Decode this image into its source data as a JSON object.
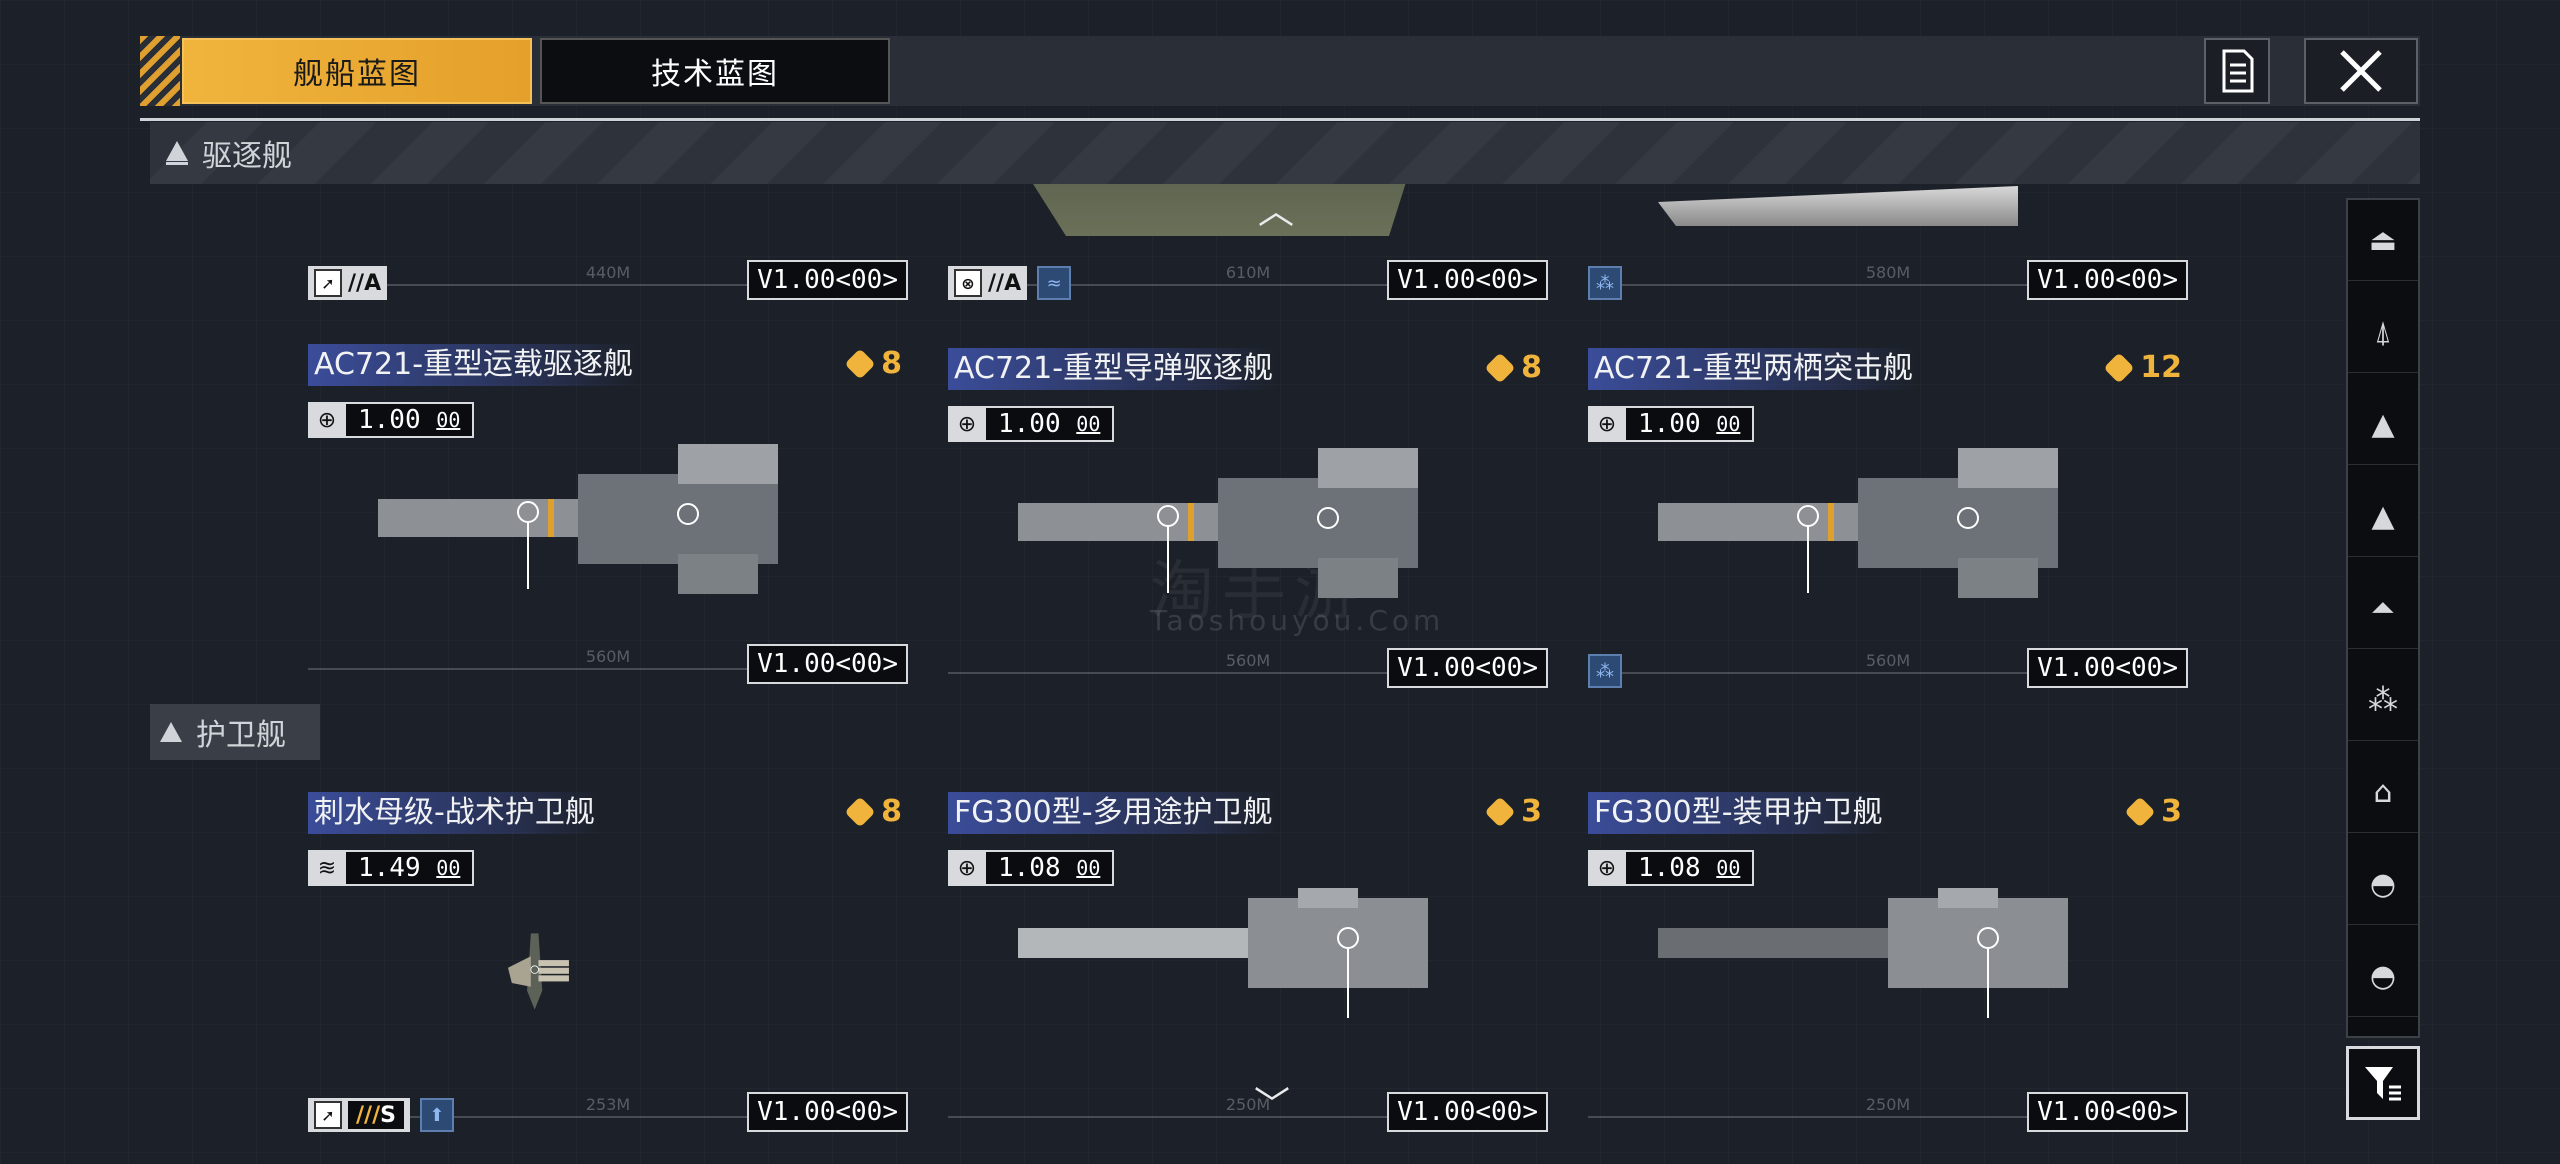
{
  "tabs": {
    "ship": "舰船蓝图",
    "tech": "技术蓝图"
  },
  "sections": {
    "destroyer": "驱逐舰",
    "frigate": "护卫舰"
  },
  "top_row": [
    {
      "length": "440M",
      "grade": "A",
      "version": "V1.00<00>"
    },
    {
      "length": "610M",
      "grade": "A",
      "version": "V1.00<00>"
    },
    {
      "length": "580M",
      "version": "V1.00<00>"
    }
  ],
  "destroyers": [
    {
      "name": "AC721-重型运载驱逐舰",
      "cost": "8",
      "val": "1.00",
      "sub": "00",
      "length": "560M",
      "version": "V1.00<00>"
    },
    {
      "name": "AC721-重型导弹驱逐舰",
      "cost": "8",
      "val": "1.00",
      "sub": "00",
      "length": "560M",
      "version": "V1.00<00>"
    },
    {
      "name": "AC721-重型两栖突击舰",
      "cost": "12",
      "val": "1.00",
      "sub": "00",
      "length": "560M",
      "version": "V1.00<00>"
    }
  ],
  "frigates": [
    {
      "name": "刺水母级-战术护卫舰",
      "cost": "8",
      "val": "1.49",
      "sub": "00",
      "length": "253M",
      "grade": "S",
      "version": "V1.00<00>"
    },
    {
      "name": "FG300型-多用途护卫舰",
      "cost": "3",
      "val": "1.08",
      "sub": "00",
      "length": "250M",
      "version": "V1.00<00>"
    },
    {
      "name": "FG300型-装甲护卫舰",
      "cost": "3",
      "val": "1.08",
      "sub": "00",
      "length": "250M",
      "version": "V1.00<00>"
    }
  ],
  "watermark": {
    "cn": "淘手游",
    "en": "Taoshouyou.Com"
  },
  "colors": {
    "accent": "#f0b43c",
    "name_bar": "#3b4d9a",
    "panel": "#0b0d10"
  },
  "icons": {
    "doc": "document-icon",
    "close": "close-icon",
    "filter": "filter-icon",
    "globe": "globe-icon",
    "cost": "blueprint-cost-icon",
    "side": [
      "carrier-class-icon",
      "cruiser-class-icon",
      "destroyer-class-icon",
      "frigate-class-icon",
      "corvette-class-icon",
      "fighter-class-icon",
      "hangar-icon",
      "dome-icon",
      "dome-small-icon"
    ]
  }
}
